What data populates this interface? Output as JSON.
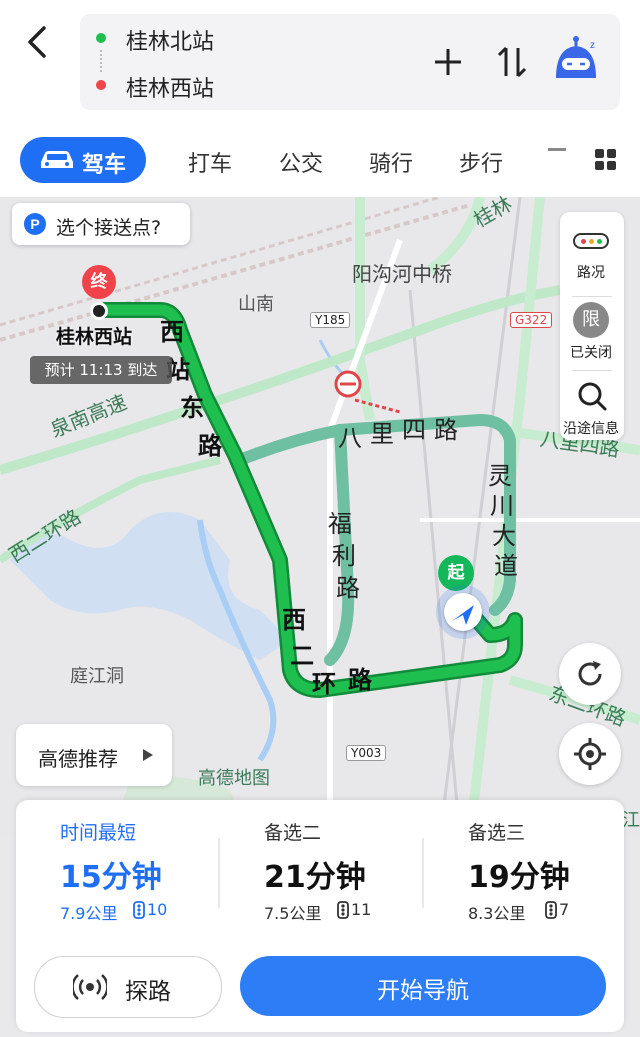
{
  "route": {
    "origin": "桂林北站",
    "destination": "桂林西站"
  },
  "tabs": {
    "drive": "驾车",
    "taxi": "打车",
    "bus": "公交",
    "ride": "骑行",
    "walk": "步行"
  },
  "map": {
    "pickup_prompt": "选个接送点?",
    "end_marker": "终",
    "start_marker": "起",
    "end_station": "桂林西站",
    "eta": "预计 11:13 到达",
    "labels": {
      "yanggou": "阳沟河中桥",
      "shannan": "山南",
      "y185": "Y185",
      "g322": "G322",
      "quannan": "泉南高速",
      "xierhuan_left": "西二环路",
      "tingjiangdong": "庭江洞",
      "y003": "Y003",
      "gaode_map": "高德地图",
      "donger": "东二环路",
      "bali_right": "八里四路",
      "gui_top": "桂林",
      "jiang_edge": "江"
    },
    "roads": {
      "xizhan_dong": [
        "西",
        "站",
        "东",
        "路"
      ],
      "bali_si": [
        "八",
        "里",
        "四",
        "路"
      ],
      "fuli": [
        "福",
        "利",
        "路"
      ],
      "lingchuan": [
        "灵",
        "川",
        "大",
        "道"
      ],
      "xi_erhuan": [
        "西",
        "二",
        "环",
        "路"
      ]
    },
    "recommend": "高德推荐",
    "side": {
      "traffic": "路况",
      "limit_icon": "限",
      "limit": "已关闭",
      "along": "沿途信息"
    }
  },
  "options": [
    {
      "title": "时间最短",
      "time": "15分钟",
      "distance": "7.9公里",
      "lights": "10"
    },
    {
      "title": "备选二",
      "time": "21分钟",
      "distance": "7.5公里",
      "lights": "11"
    },
    {
      "title": "备选三",
      "time": "19分钟",
      "distance": "8.3公里",
      "lights": "7"
    }
  ],
  "buttons": {
    "explore": "探路",
    "start_nav": "开始导航"
  },
  "colors": {
    "accent": "#1f6ff5",
    "route_green": "#1fbf4f",
    "end_red": "#f0444a",
    "start_green": "#14b85a"
  }
}
